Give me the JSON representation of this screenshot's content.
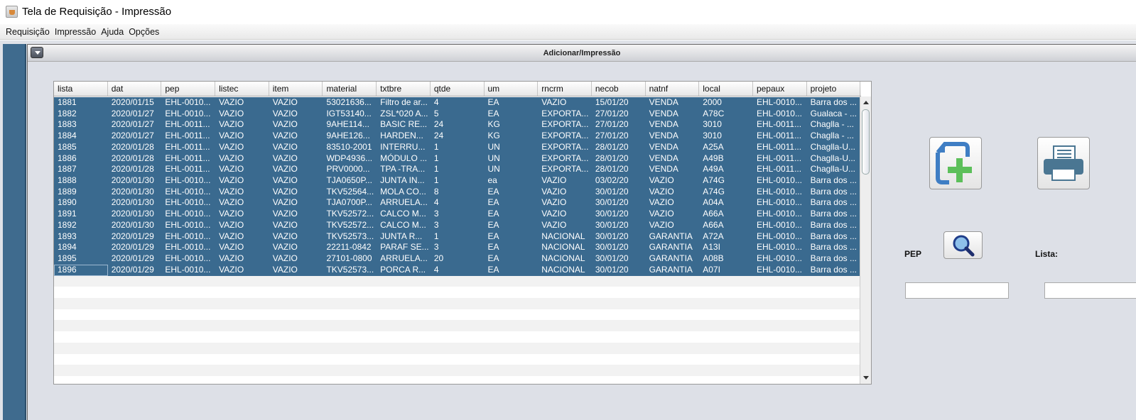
{
  "window": {
    "title": "Tela de Requisição - Impressão"
  },
  "menubar": [
    "Requisição",
    "Impressão",
    "Ajuda",
    "Opções"
  ],
  "frame": {
    "title": "Adicionar/Impressão"
  },
  "table": {
    "columns": [
      "lista",
      "dat",
      "pep",
      "listec",
      "item",
      "material",
      "txtbre",
      "qtde",
      "um",
      "rncrm",
      "necob",
      "natnf",
      "local",
      "pepaux",
      "projeto"
    ],
    "rows": [
      [
        "1881",
        "2020/01/15",
        "EHL-0010...",
        "VAZIO",
        "VAZIO",
        "53021636...",
        "Filtro de ar...",
        "4",
        "EA",
        "VAZIO",
        "15/01/20",
        "VENDA",
        "2000",
        "EHL-0010...",
        "Barra dos ..."
      ],
      [
        "1882",
        "2020/01/27",
        "EHL-0010...",
        "VAZIO",
        "VAZIO",
        "IGT53140...",
        "ZSL*020 A...",
        "5",
        "EA",
        "EXPORTA...",
        "27/01/20",
        "VENDA",
        "A78C",
        "EHL-0010...",
        "Gualaca - ..."
      ],
      [
        "1883",
        "2020/01/27",
        "EHL-0011...",
        "VAZIO",
        "VAZIO",
        "9AHE114...",
        "BASIC RE...",
        "24",
        "KG",
        "EXPORTA...",
        "27/01/20",
        "VENDA",
        "3010",
        "EHL-0011...",
        "Chaglla - ..."
      ],
      [
        "1884",
        "2020/01/27",
        "EHL-0011...",
        "VAZIO",
        "VAZIO",
        "9AHE126...",
        "HARDEN...",
        "24",
        "KG",
        "EXPORTA...",
        "27/01/20",
        "VENDA",
        "3010",
        "EHL-0011...",
        "Chaglla - ..."
      ],
      [
        "1885",
        "2020/01/28",
        "EHL-0011...",
        "VAZIO",
        "VAZIO",
        "83510-2001",
        "INTERRU...",
        "1",
        "UN",
        "EXPORTA...",
        "28/01/20",
        "VENDA",
        "A25A",
        "EHL-0011...",
        "Chaglla-U..."
      ],
      [
        "1886",
        "2020/01/28",
        "EHL-0011...",
        "VAZIO",
        "VAZIO",
        "WDP4936...",
        "MÓDULO ...",
        "1",
        "UN",
        "EXPORTA...",
        "28/01/20",
        "VENDA",
        "A49B",
        "EHL-0011...",
        "Chaglla-U..."
      ],
      [
        "1887",
        "2020/01/28",
        "EHL-0011...",
        "VAZIO",
        "VAZIO",
        "PRV0000...",
        "TPA -TRA...",
        "1",
        "UN",
        "EXPORTA...",
        "28/01/20",
        "VENDA",
        "A49A",
        "EHL-0011...",
        "Chaglla-U..."
      ],
      [
        "1888",
        "2020/01/30",
        "EHL-0010...",
        "VAZIO",
        "VAZIO",
        "TJA0650P...",
        "JUNTA IN...",
        "1",
        "ea",
        "VAZIO",
        "03/02/20",
        "VAZIO",
        "A74G",
        "EHL-0010...",
        "Barra dos ..."
      ],
      [
        "1889",
        "2020/01/30",
        "EHL-0010...",
        "VAZIO",
        "VAZIO",
        "TKV52564...",
        "MOLA CO...",
        "8",
        "EA",
        "VAZIO",
        "30/01/20",
        "VAZIO",
        "A74G",
        "EHL-0010...",
        "Barra dos ..."
      ],
      [
        "1890",
        "2020/01/30",
        "EHL-0010...",
        "VAZIO",
        "VAZIO",
        "TJA0700P...",
        "ARRUELA...",
        "4",
        "EA",
        "VAZIO",
        "30/01/20",
        "VAZIO",
        "A04A",
        "EHL-0010...",
        "Barra dos ..."
      ],
      [
        "1891",
        "2020/01/30",
        "EHL-0010...",
        "VAZIO",
        "VAZIO",
        "TKV52572...",
        "CALCO M...",
        "3",
        "EA",
        "VAZIO",
        "30/01/20",
        "VAZIO",
        "A66A",
        "EHL-0010...",
        "Barra dos ..."
      ],
      [
        "1892",
        "2020/01/30",
        "EHL-0010...",
        "VAZIO",
        "VAZIO",
        "TKV52572...",
        "CALCO M...",
        "3",
        "EA",
        "VAZIO",
        "30/01/20",
        "VAZIO",
        "A66A",
        "EHL-0010...",
        "Barra dos ..."
      ],
      [
        "1893",
        "2020/01/29",
        "EHL-0010...",
        "VAZIO",
        "VAZIO",
        "TKV52573...",
        "JUNTA R...",
        "1",
        "EA",
        "NACIONAL",
        "30/01/20",
        "GARANTIA",
        "A72A",
        "EHL-0010...",
        "Barra dos ..."
      ],
      [
        "1894",
        "2020/01/29",
        "EHL-0010...",
        "VAZIO",
        "VAZIO",
        "22211-0842",
        "PARAF SE...",
        "3",
        "EA",
        "NACIONAL",
        "30/01/20",
        "GARANTIA",
        "A13I",
        "EHL-0010...",
        "Barra dos ..."
      ],
      [
        "1895",
        "2020/01/29",
        "EHL-0010...",
        "VAZIO",
        "VAZIO",
        "27101-0800",
        "ARRUELA...",
        "20",
        "EA",
        "NACIONAL",
        "30/01/20",
        "GARANTIA",
        "A08B",
        "EHL-0010...",
        "Barra dos ..."
      ],
      [
        "1896",
        "2020/01/29",
        "EHL-0010...",
        "VAZIO",
        "VAZIO",
        "TKV52573...",
        "PORCA R...",
        "4",
        "EA",
        "NACIONAL",
        "30/01/20",
        "GARANTIA",
        "A07I",
        "EHL-0010...",
        "Barra dos ..."
      ]
    ],
    "selection_color": "#3a6a8f"
  },
  "panel": {
    "add_icon": "add-document-icon",
    "print_icon": "printer-icon",
    "search_icon": "magnifier-icon",
    "pep_label": "PEP",
    "lista_label": "Lista:",
    "pep_value": "",
    "lista_value": ""
  }
}
